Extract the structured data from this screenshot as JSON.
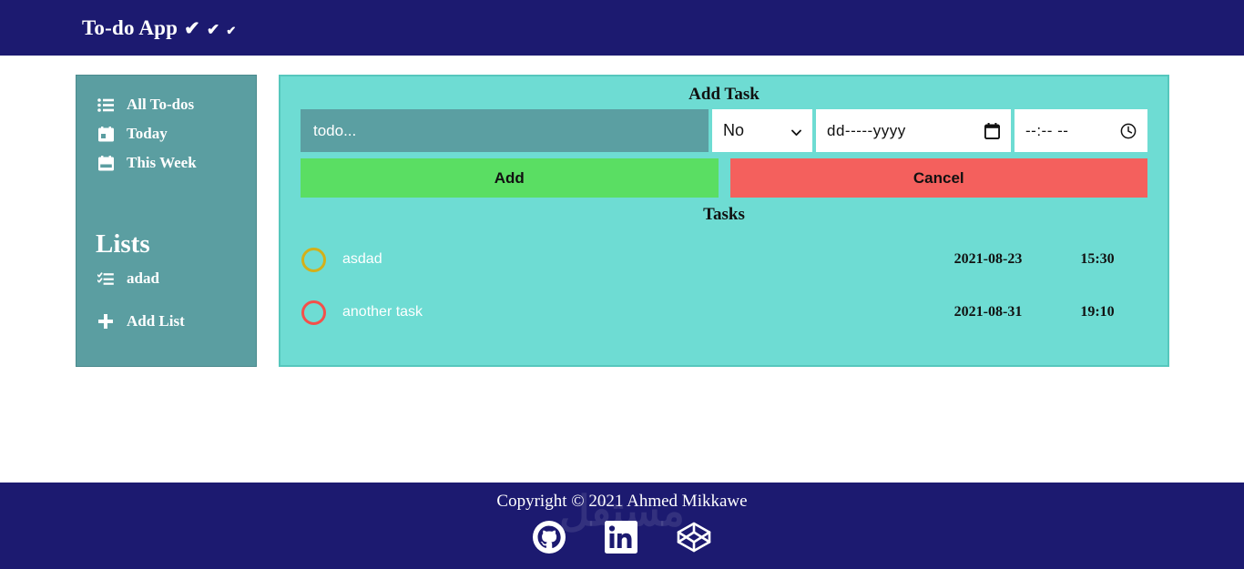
{
  "header": {
    "title": "To-do App",
    "check_large": "✔",
    "check_medium": "✔",
    "check_small": "✔"
  },
  "sidebar": {
    "items": [
      {
        "label": "All To-dos",
        "icon": "list-ul-icon"
      },
      {
        "label": "Today",
        "icon": "calendar-day-icon"
      },
      {
        "label": "This Week",
        "icon": "calendar-week-icon"
      }
    ],
    "lists_heading": "Lists",
    "lists": [
      {
        "label": "adad",
        "icon": "list-check-icon"
      }
    ],
    "add_list_label": "Add List",
    "add_list_icon": "plus-icon",
    "background_color": "#5b9ea1"
  },
  "panel": {
    "title": "Add Task",
    "background_color": "#6edcd3",
    "form": {
      "todo_placeholder": "todo...",
      "todo_value": "",
      "select_value": "No",
      "select_options": [
        "No"
      ],
      "date_value": "",
      "date_placeholder": "dd-----yyyy",
      "date_icon": "calendar-icon",
      "time_value": "",
      "time_placeholder": "--:--  --",
      "time_icon": "clock-icon"
    },
    "buttons": {
      "add_label": "Add",
      "add_color": "#5ade63",
      "cancel_label": "Cancel",
      "cancel_color": "#f4605d"
    },
    "tasks_title": "Tasks",
    "tasks": [
      {
        "name": "asdad",
        "date": "2021-08-23",
        "time": "15:30",
        "circle_color": "#d4b019",
        "done": false
      },
      {
        "name": "another task",
        "date": "2021-08-31",
        "time": "19:10",
        "circle_color": "#f4504a",
        "done": false
      }
    ]
  },
  "footer": {
    "copyright": "Copyright © 2021 Ahmed Mikkawe",
    "watermark": "مستقل",
    "socials": [
      {
        "name": "github-icon"
      },
      {
        "name": "linkedin-icon"
      },
      {
        "name": "codepen-icon"
      }
    ],
    "background_color": "#1c1a70"
  }
}
